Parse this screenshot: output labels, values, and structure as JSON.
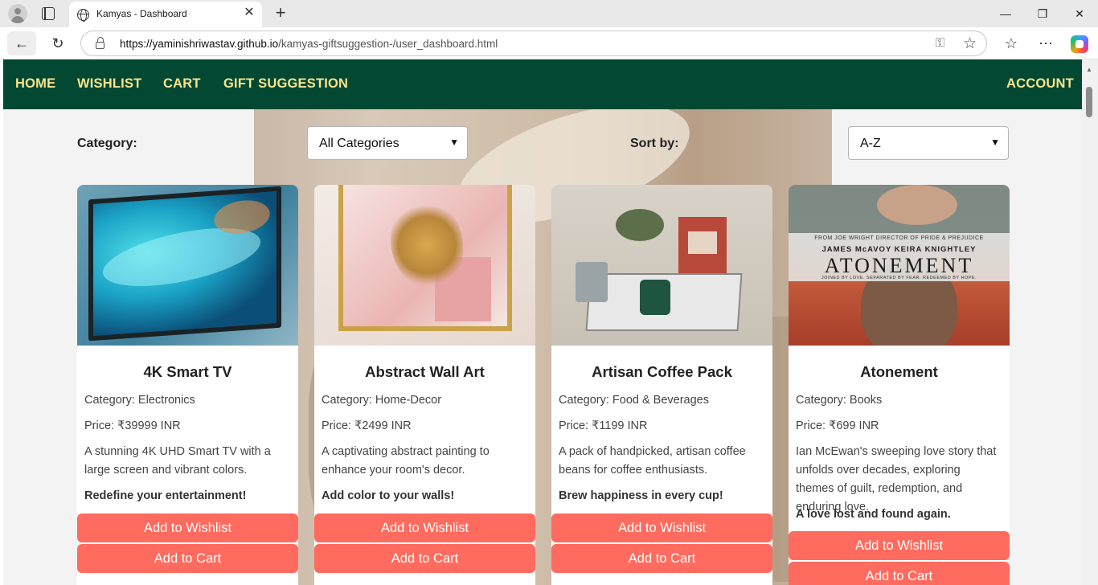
{
  "browser": {
    "tab_title": "Kamyas - Dashboard",
    "tab_close": "✕",
    "new_tab": "+",
    "url_domain": "https://yaminishriwastav.github.io",
    "url_path": "/kamyas-giftsuggestion-/user_dashboard.html",
    "back": "←",
    "reload": "↻",
    "win_min": "—",
    "win_max": "❐",
    "win_close": "✕"
  },
  "nav": {
    "home": "HOME",
    "wishlist": "WISHLIST",
    "cart": "CART",
    "gift_suggestion": "GIFT SUGGESTION",
    "account": "ACCOUNT"
  },
  "filters": {
    "category_label": "Category:",
    "category_value": "All Categories",
    "sort_label": "Sort by:",
    "sort_value": "A-Z"
  },
  "products": [
    {
      "name": "4K Smart TV",
      "category": "Category: Electronics",
      "price": "Price: ₹39999 INR",
      "description": "A stunning 4K UHD Smart TV with a large screen and vibrant colors.",
      "tagline": "Redefine your entertainment!",
      "wishlist_label": "Add to Wishlist",
      "cart_label": "Add to Cart"
    },
    {
      "name": "Abstract Wall Art",
      "category": "Category: Home-Decor",
      "price": "Price: ₹2499 INR",
      "description": "A captivating abstract painting to enhance your room's decor.",
      "tagline": "Add color to your walls!",
      "wishlist_label": "Add to Wishlist",
      "cart_label": "Add to Cart"
    },
    {
      "name": "Artisan Coffee Pack",
      "category": "Category: Food & Beverages",
      "price": "Price: ₹1199 INR",
      "description": "A pack of handpicked, artisan coffee beans for coffee enthusiasts.",
      "tagline": "Brew happiness in every cup!",
      "wishlist_label": "Add to Wishlist",
      "cart_label": "Add to Cart"
    },
    {
      "name": "Atonement",
      "category": "Category: Books",
      "price": "Price: ₹699 INR",
      "description": "Ian McEwan's sweeping love story that unfolds over decades, exploring themes of guilt, redemption, and enduring love.",
      "tagline": "A love lost and found again.",
      "wishlist_label": "Add to Wishlist",
      "cart_label": "Add to Cart",
      "poster": {
        "top_line": "FROM JOE WRIGHT DIRECTOR OF PRIDE & PREJUDICE",
        "names": "JAMES McAVOY   KEIRA KNIGHTLEY",
        "title": "ATONEMENT",
        "tagline": "JOINED BY LOVE. SEPARATED BY FEAR. REDEEMED BY HOPE."
      }
    }
  ],
  "colors": {
    "navbar": "#034833",
    "nav_text": "#f6e58d",
    "button": "#ff6b5e"
  }
}
